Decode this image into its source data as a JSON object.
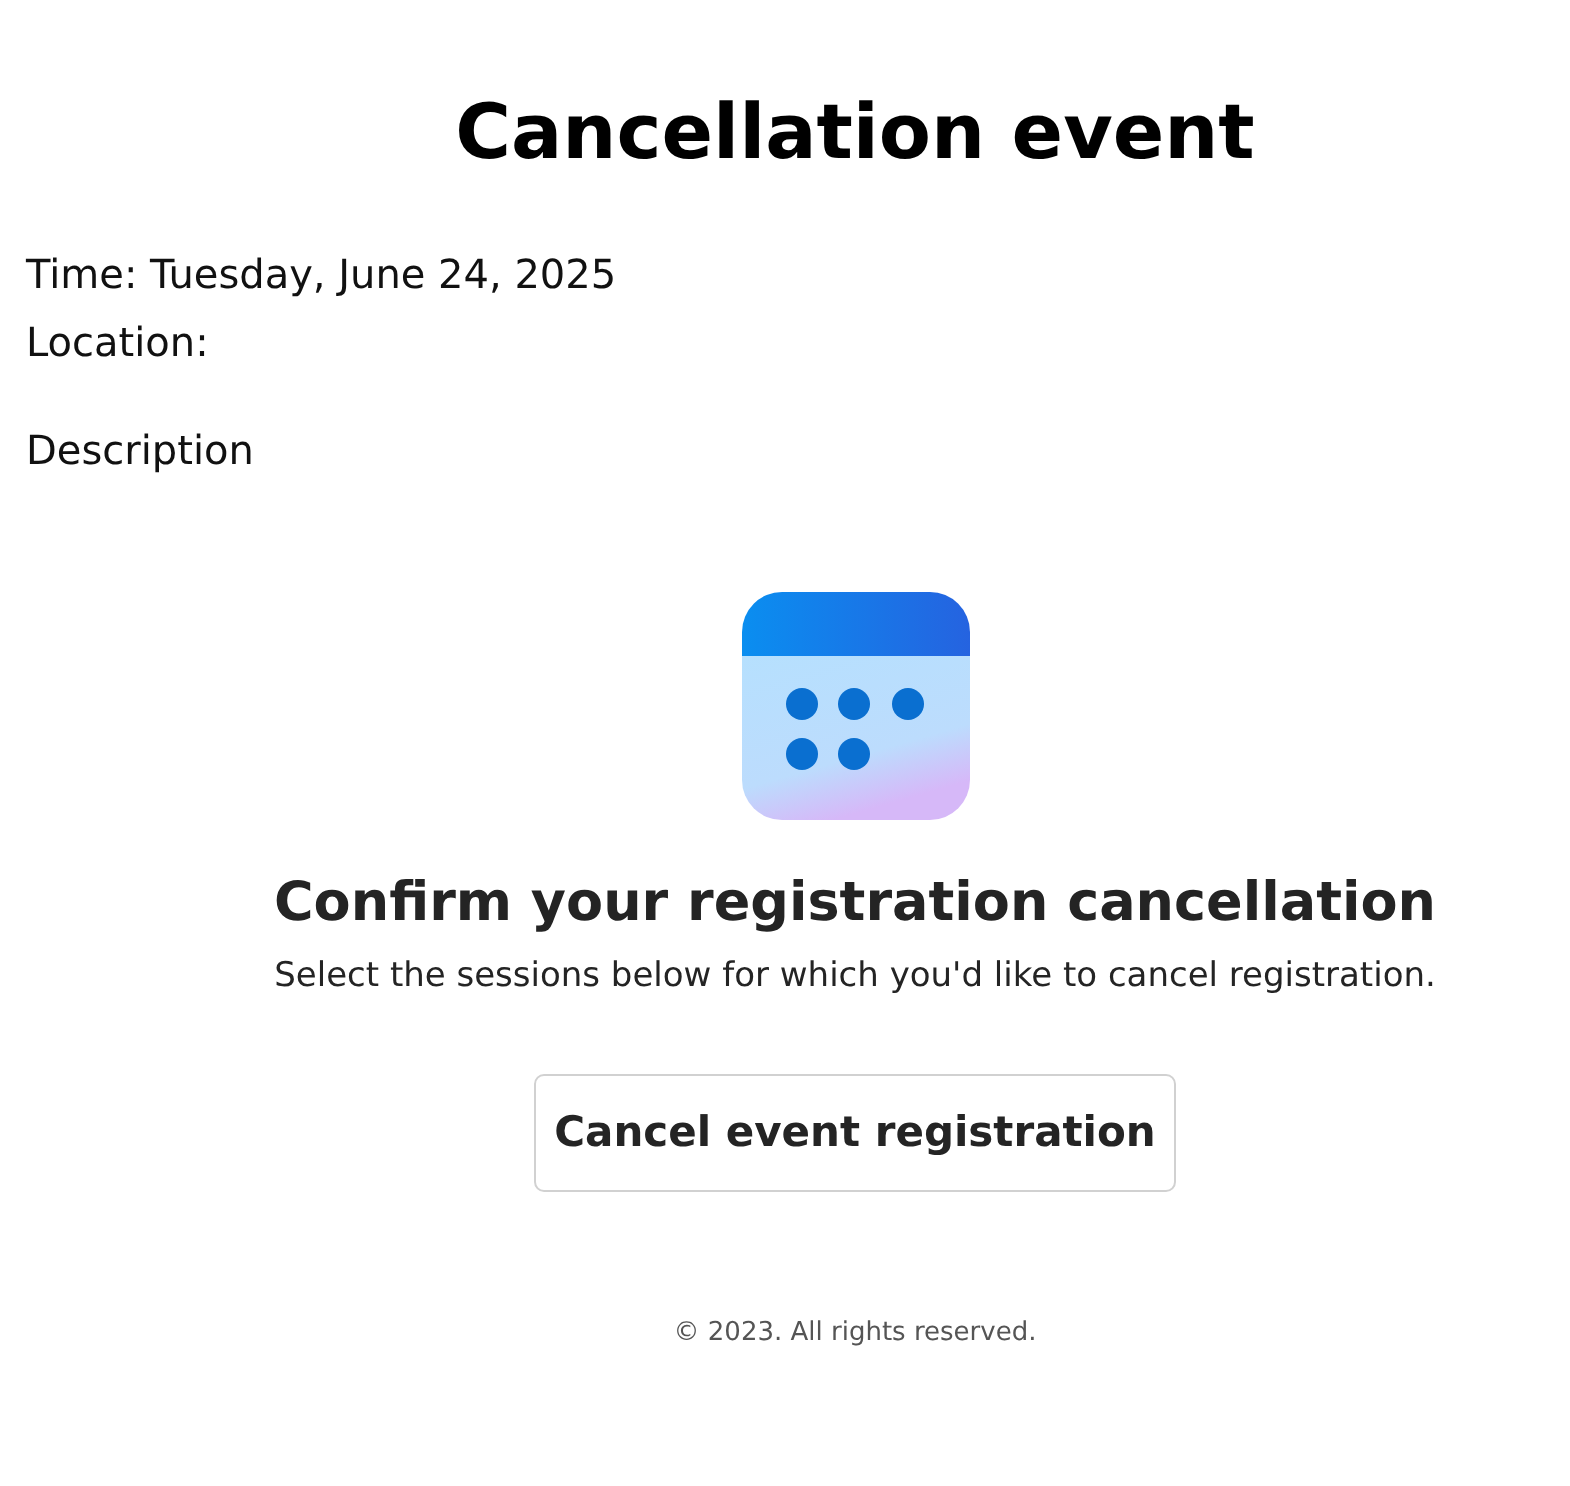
{
  "title": "Cancellation event",
  "details": [
    {
      "label": "Time: Tuesday, June 24, 2025"
    },
    {
      "label": "Location:"
    }
  ],
  "description_heading": "Description",
  "confirm": {
    "heading": "Confirm your registration cancellation",
    "text": "Select the sessions below for which you'd like to cancel registration."
  },
  "button": "Cancel event registration",
  "footer": "© 2023. All rights reserved."
}
